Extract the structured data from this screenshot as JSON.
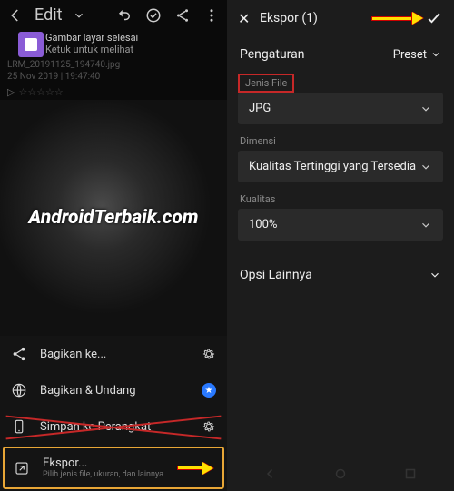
{
  "left": {
    "edit_title": "Edit",
    "notif_title": "Gambar layar selesai",
    "notif_sub": "Ketuk untuk melihat",
    "meta_filename": "LRM_20191125_194740.jpg",
    "meta_timestamp": "25 Nov 2019 | 19:47:40",
    "stars": "☆☆☆☆☆",
    "watermark": "AndroidTerbaik.com",
    "share": {
      "share_to": "Bagikan ke...",
      "share_invite": "Bagikan & Undang",
      "save_device": "Simpan ke Perangkat",
      "export": "Ekspor...",
      "export_sub": "Pilih jenis file, ukuran, dan lainnya"
    }
  },
  "right": {
    "title": "Ekspor (1)",
    "settings_label": "Pengaturan",
    "preset_label": "Preset",
    "file_type_label": "Jenis File",
    "file_type_value": "JPG",
    "dimension_label": "Dimensi",
    "dimension_value": "Kualitas Tertinggi yang Tersedia",
    "quality_label": "Kualitas",
    "quality_value": "100%",
    "other_options": "Opsi Lainnya"
  }
}
